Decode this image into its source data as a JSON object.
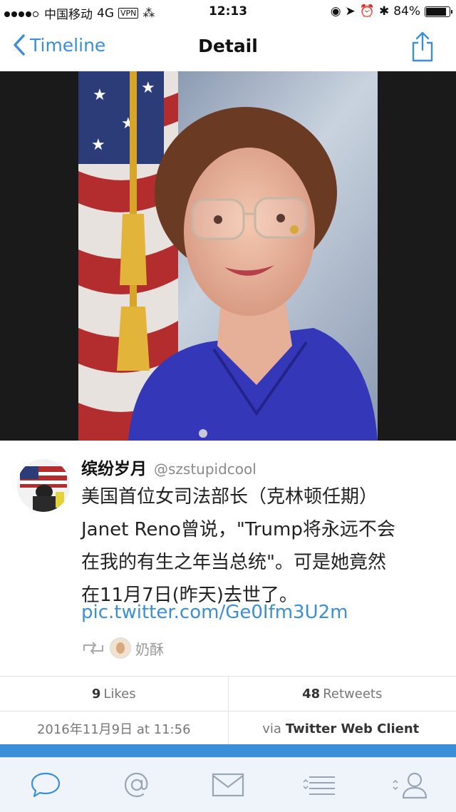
{
  "status_bar": {
    "carrier": "中国移动",
    "network": "4G",
    "vpn": "VPN",
    "time": "12:13",
    "battery": "84%"
  },
  "nav": {
    "back_label": "Timeline",
    "title": "Detail"
  },
  "tweet": {
    "author_name": "缤纷岁月",
    "author_handle": "@szstupidcool",
    "text_lines": [
      "美国首位女司法部长（克林顿任期）",
      "Janet Reno曾说，\"Trump将永远不会",
      "在我的有生之年当总统\"。可是她竟然",
      "在11月7日(昨天)去世了。"
    ],
    "link": "pic.twitter.com/Ge0Ifm3U2m",
    "retweeted_by": "奶酥"
  },
  "stats": {
    "likes_count": "9",
    "likes_label": "Likes",
    "retweets_count": "48",
    "retweets_label": "Retweets",
    "date": "2016年11月9日 at 11:56",
    "via_prefix": "via",
    "client": "Twitter Web Client"
  },
  "tabbar": {
    "items": [
      "chat-bubble-icon",
      "at-icon",
      "envelope-icon",
      "list-icon",
      "profile-icon"
    ]
  },
  "colors": {
    "accent": "#3b8ed8",
    "photo_background": "#1a1a1a"
  }
}
